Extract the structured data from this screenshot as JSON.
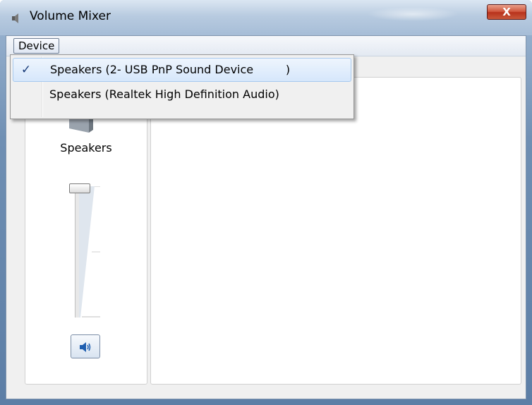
{
  "window": {
    "title": "Volume Mixer",
    "close_glyph": "X",
    "icon": "speaker-icon"
  },
  "menubar": {
    "device_label": "Device"
  },
  "device_menu": {
    "items": [
      {
        "label": "Speakers (2- USB PnP Sound Device         )",
        "checked": true,
        "check_glyph": "✓"
      },
      {
        "label": "Speakers (Realtek High Definition Audio)",
        "checked": false
      }
    ]
  },
  "device_panel": {
    "label": "Speakers",
    "volume_level": 1.0,
    "mute_icon": "speaker-volume-icon",
    "muted": false
  },
  "colors": {
    "title_bar": "#b8cbe0",
    "close_button": "#c8573a",
    "menu_highlight": "#d6e7fb"
  }
}
